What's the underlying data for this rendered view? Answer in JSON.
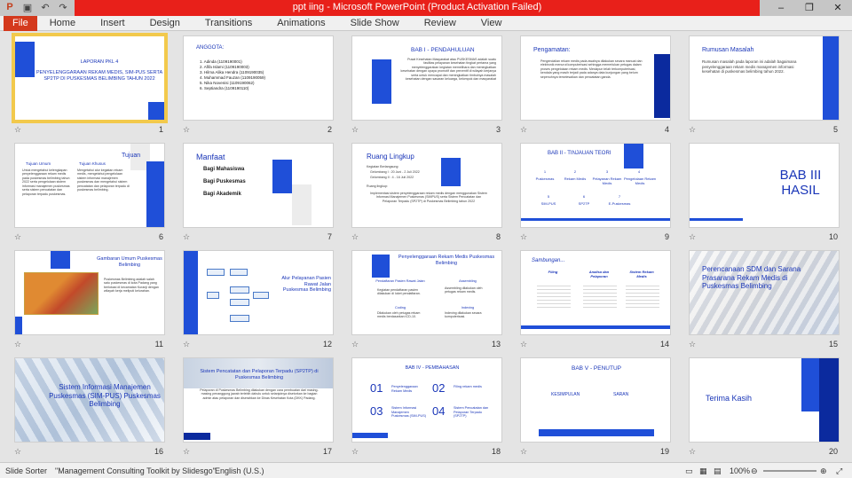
{
  "window": {
    "title": "ppt iing  -  Microsoft PowerPoint (Product Activation Failed)",
    "qat_icons": [
      "powerpoint-icon",
      "save-icon",
      "undo-icon",
      "redo-icon",
      "customize-icon"
    ]
  },
  "ribbon": {
    "file": "File",
    "tabs": [
      "Home",
      "Insert",
      "Design",
      "Transitions",
      "Animations",
      "Slide Show",
      "Review",
      "View"
    ]
  },
  "slides": {
    "s1": {
      "num": "1",
      "heading": "LAPORAN PKL 4",
      "title": "PENYELENGGARAAN REKAM MEDIS, SIM-PUS SERTA SP2TP DI PUSKESMAS BELIMBING TAHUN 2022"
    },
    "s2": {
      "num": "2",
      "heading": "ANGGOTA:",
      "members": [
        "1.     Adinda                         (1109190001)",
        "2.     Afifa Islami                 (1109190003)",
        "3.     Hilma Alika Hendra     (1109190035)",
        "4.     Muhammad Fauzan    (1109190059)",
        "5.     Nika Novenisi             (1109190062)",
        "6.     Septiandra                 (1109190110)"
      ]
    },
    "s3": {
      "num": "3",
      "heading": "BAB I - PENDAHULUAN",
      "body": "Pusat Kesehatan Masyarakat atau PUSKESMAS adalah suatu fasilitas pelayanan kesehatan tingkat pertama yang menyelenggarakan kegiatan memelihara dan meningkatkan kesehatan dengan upaya promotif dan preventif di wilayah kerjanya serta untuk mencapai dan meningkatkan timbulnya masalah kesehatan dengan sasaran keluarga, kelompok dan masyarakat"
    },
    "s4": {
      "num": "4",
      "heading": "Pengamatan:",
      "body": "Pengendalian rekam medis pada awalnya dilakukan secara manual dan elektronik menurut komputerisasi sehingga memerlukan petugas dalam proses pengelolaan rekam medis. Meskipun telah terkomputerisasi, kendala yang masih terjadi pada adanya data kunjungan yang belum sepenuhnya terselesaikan dan pencatatan ganda."
    },
    "s5": {
      "num": "5",
      "heading": "Rumusan Masalah",
      "body": "Rumusan masalah pada laporan ini adalah bagaimana penyelenggaraan rekam medis manajemen informasi kesehatan di puskesmas belimbing tahun 2022."
    },
    "s6": {
      "num": "6",
      "heading": "Tujuan",
      "col1_title": "Tujuan Umum",
      "col2_title": "Tujuan Khusus",
      "col1": "Untuk mengetahui kelengkapan penyelenggaraan rekam medis pada puskesmas belimbing tahun 2022 serta pengelolaan sistem informasi manajemen puskesmas serta sistem pencatatan dan pelaporan terpadu puskesmas.",
      "col2": "Mengetahui alur kegiatan rekam medis, mengetahui pengelolaan sistem informasi manajemen puskesmas dan mengetahui sistem pencatatan dan pelaporan terpadu di puskesmas belimbing."
    },
    "s7": {
      "num": "7",
      "heading": "Manfaat",
      "items": [
        "Bagi Mahasiswa",
        "Bagi Puskesmas",
        "Bagi Akademik"
      ]
    },
    "s8": {
      "num": "8",
      "heading": "Ruang Lingkup",
      "line0": "Kegiatan Berlangsung:",
      "line1": "Gelombang I : 20 Juni - 2 Juli 2022",
      "line2": "Gelombang II : 4 - 16 Juli 2022",
      "line3": "Ruang lingkup:",
      "body": "Implementasi sistem penyelenggaraan rekam medis dengan menggunakan Sistem Informasi Manajemen Puskesmas (SIMPUS) serta Sistem Pencatatan dan Pelaporan Terpadu (SP2TP) di Puskesmas Belimbing tahun 2022"
    },
    "s9": {
      "num": "9",
      "heading": "BAB II - TINJAUAN TEORI",
      "items": [
        {
          "n": "1",
          "label": "Puskesmas"
        },
        {
          "n": "2",
          "label": "Rekam Medis"
        },
        {
          "n": "3",
          "label": "Pelayanan Rekam Medis"
        },
        {
          "n": "4",
          "label": "Pengelolaan Rekam Medis"
        },
        {
          "n": "5",
          "label": "SIM-PUS"
        },
        {
          "n": "6",
          "label": "SP2TP"
        },
        {
          "n": "7",
          "label": "E-Puskesmas"
        }
      ]
    },
    "s10": {
      "num": "10",
      "heading": "BAB III HASIL"
    },
    "s11": {
      "num": "11",
      "heading": "Gambaran Umum Puskesmas Belimbing",
      "body": "Puskesmas Belimbing adalah salah satu puskesmas di kota Padang yang berlokasi di kecamatan Kuranji dengan wilayah kerja meliputi kelurahan."
    },
    "s12": {
      "num": "12",
      "heading": "Alur Pelayanan Pasien Rawat Jalan Puskesmas Belimbing"
    },
    "s13": {
      "num": "13",
      "heading": "Penyelenggaraan Rekam Medis Puskesmas Belimbing",
      "cols": [
        {
          "title": "Pendaftaran Pasien Rawat Jalan",
          "body": "Kegiatan pendaftaran pasien dilakukan di loket pendaftaran."
        },
        {
          "title": "Assembling",
          "body": "Assembling dilakukan oleh petugas rekam medis."
        },
        {
          "title": "Coding",
          "body": "Dilakukan oleh petugas rekam medis berdasarkan ICD-10."
        },
        {
          "title": "Indexing",
          "body": "Indexing dilakukan secara komputerisasi."
        }
      ]
    },
    "s14": {
      "num": "14",
      "heading": "Sambungan...",
      "cols": [
        "Filing",
        "Analisa dan Pelaporan",
        "Sistem Rekam Medis"
      ]
    },
    "s15": {
      "num": "15",
      "heading": "Perencanaan SDM dan Sarana Prasarana Rekam Medis di Puskesmas Belimbing"
    },
    "s16": {
      "num": "16",
      "heading": "Sistem Informasi Manajemen Puskesmas (SIM-PUS) Puskesmas Belimbing"
    },
    "s17": {
      "num": "17",
      "heading": "Sistem Pencatatan dan Pelaporan Terpadu (SP2TP) di Puskesmas Belimbing",
      "body": "Pelaporan di Puskesmas Belimbing dilakukan dengan cara pembuatan dari masing-masing penanggung jawab terlebih dahulu untuk selanjutnya disetorkan ke bagian admin atau pelaporan dan diserahkan ke Dinas Kesehatan Kota (DKK) Padang."
    },
    "s18": {
      "num": "18",
      "heading": "BAB IV - PEMBAHASAN",
      "items": [
        {
          "n": "01",
          "label": "Penyelenggaraan Rekam Medis"
        },
        {
          "n": "02",
          "label": "Filing rekam medis"
        },
        {
          "n": "03",
          "label": "Sistem Informasi Manajemen Puskesmas (SIM-PUS)"
        },
        {
          "n": "04",
          "label": "Sistem Pencatatan dan Pelaporan Terpadu (SP2TP)"
        }
      ]
    },
    "s19": {
      "num": "19",
      "heading": "BAB V - PENUTUP",
      "left": "KESIMPULAN",
      "right": "SARAN"
    },
    "s20": {
      "num": "20",
      "heading": "Terima Kasih"
    }
  },
  "status": {
    "view": "Slide Sorter",
    "theme": "\"Management Consulting Toolkit by Slidesgo\"",
    "language": "English (U.S.)",
    "zoom": "100%"
  },
  "colors": {
    "accent": "#1f4fd8",
    "file_tab": "#d4391d",
    "titlebar_red": "#e8201a",
    "selection": "#f2c94c"
  }
}
